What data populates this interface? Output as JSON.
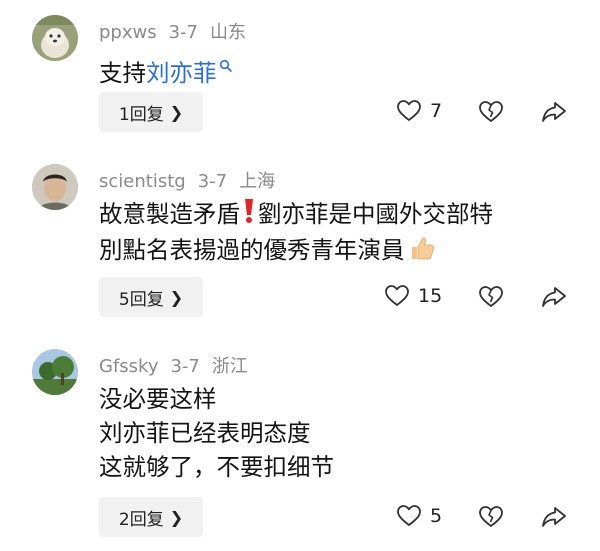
{
  "comments": [
    {
      "username": "ppxws",
      "date": "3-7",
      "location": "山东",
      "text_prefix": "支持",
      "mention": "刘亦菲",
      "reply_label": "1回复",
      "like_count": "7"
    },
    {
      "username": "scientistg",
      "date": "3-7",
      "location": "上海",
      "line1": "故意製造矛盾",
      "line1_rest": "劉亦菲是中國外交部特",
      "line2": "別點名表揚過的優秀青年演員",
      "reply_label": "5回复",
      "like_count": "15"
    },
    {
      "username": "Gfssky",
      "date": "3-7",
      "location": "浙江",
      "lines": [
        "没必要这样",
        "刘亦菲已经表明态度",
        "这就够了，不要扣细节"
      ],
      "reply_label": "2回复",
      "like_count": "5"
    }
  ],
  "icons": {
    "like": "heart-outline-icon",
    "dislike": "broken-heart-icon",
    "share": "share-arrow-icon",
    "search": "search-icon",
    "chevron": "chevron-right-icon",
    "exclamation": "red-exclamation-icon",
    "thumbs": "thumbs-up-icon"
  }
}
